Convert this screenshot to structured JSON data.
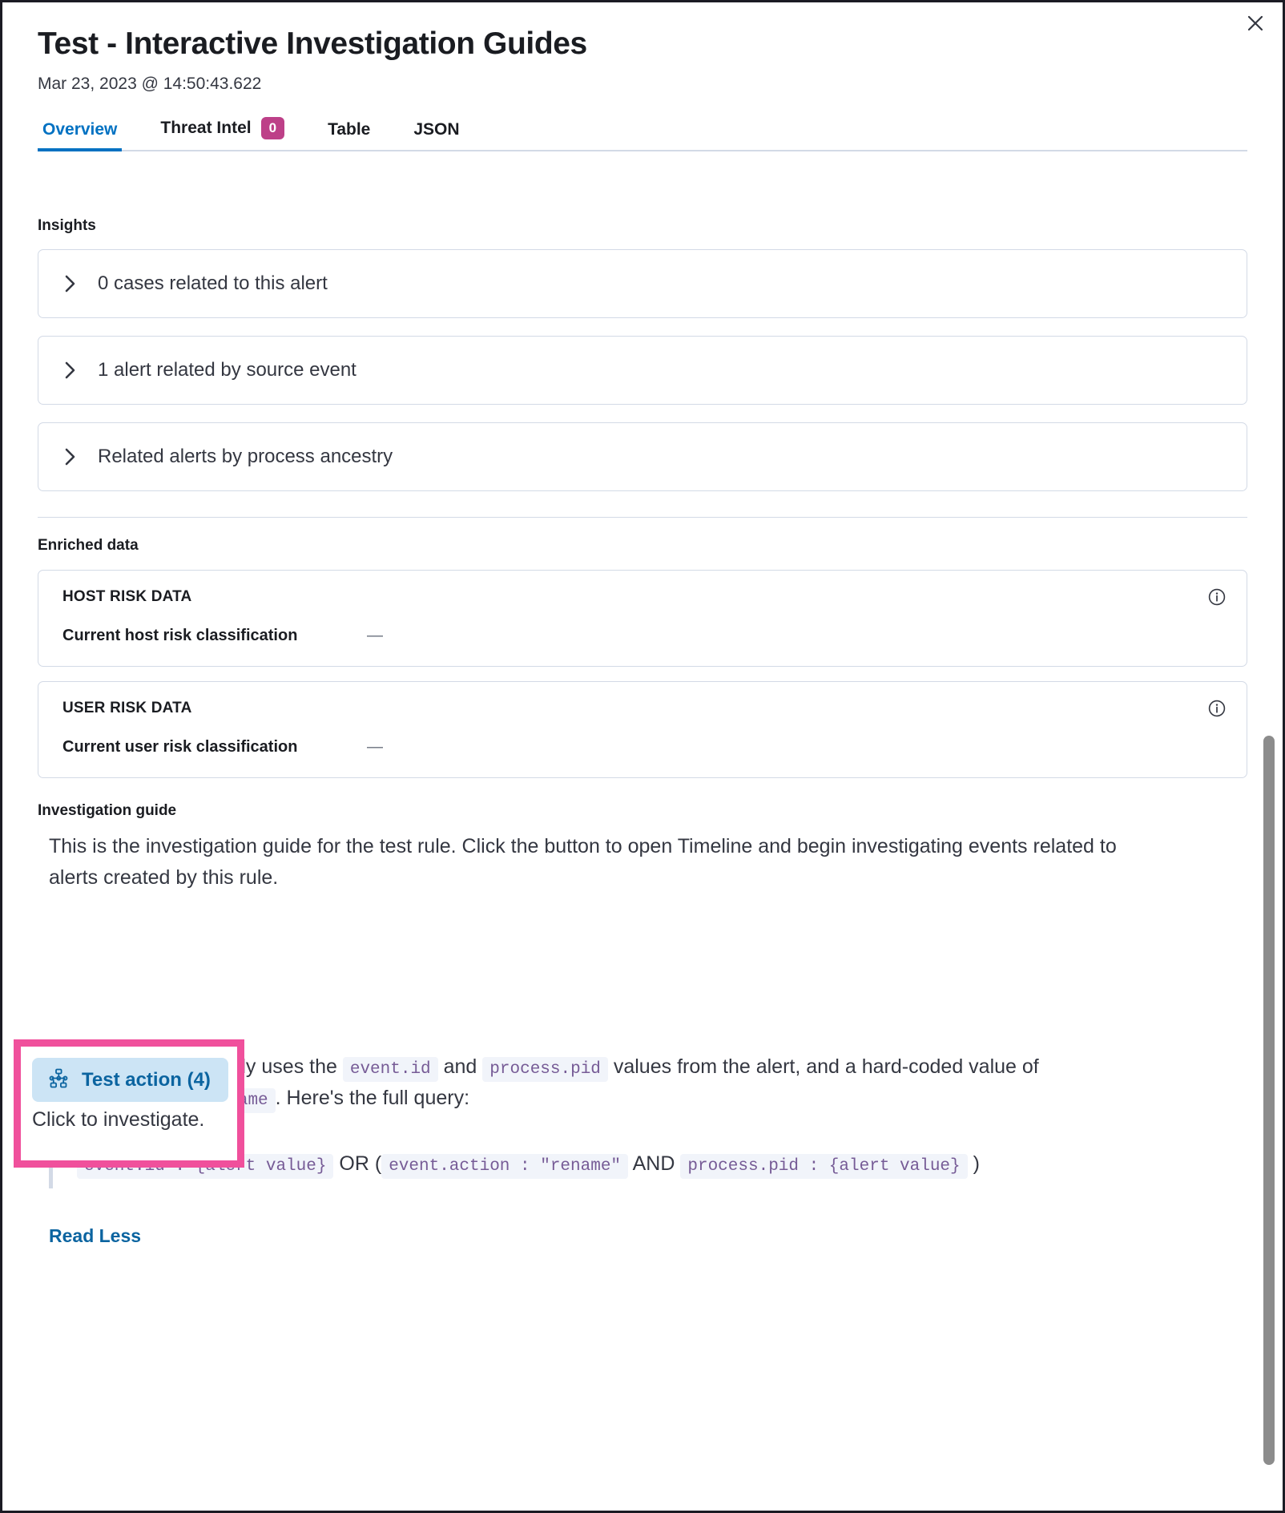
{
  "header": {
    "title": "Test - Interactive Investigation Guides",
    "timestamp": "Mar 23, 2023 @ 14:50:43.622",
    "close_label": "×"
  },
  "tabs": [
    {
      "label": "Overview",
      "badge": null,
      "active": true
    },
    {
      "label": "Threat Intel",
      "badge": "0",
      "active": false
    },
    {
      "label": "Table",
      "badge": null,
      "active": false
    },
    {
      "label": "JSON",
      "badge": null,
      "active": false
    }
  ],
  "insights": {
    "label": "Insights",
    "items": [
      {
        "text": "0 cases related to this alert"
      },
      {
        "text": "1 alert related by source event"
      },
      {
        "text": "Related alerts by process ancestry"
      }
    ]
  },
  "enriched": {
    "label": "Enriched data",
    "cards": [
      {
        "title": "HOST RISK DATA",
        "key": "Current host risk classification",
        "value": "—"
      },
      {
        "title": "USER RISK DATA",
        "key": "Current user risk classification",
        "value": "—"
      }
    ]
  },
  "guide": {
    "label": "Investigation guide",
    "intro": "This is the investigation guide for the test rule. Click the button to open Timeline and begin investigating events related to alerts created by this rule.",
    "action_button_label": "Test action (4)",
    "click_note": "Click to investigate.",
    "desc_part1": "This action dynamically uses the ",
    "code_event_id": "event.id",
    "desc_and": " and ",
    "code_process_pid": "process.pid",
    "desc_part2": " values from the alert, and a hard-coded value of ",
    "code_event_action": "event.action : rename",
    "desc_part3": ". Here's the full query:",
    "query": {
      "code1": "event.id : {alert value}",
      "op1": "OR",
      "paren_open": "(",
      "code2": "event.action : \"rename\"",
      "op2": "AND",
      "code3": "process.pid : {alert value}",
      "paren_close": ")"
    },
    "read_less_label": "Read Less"
  },
  "colors": {
    "accent_blue": "#0071c2",
    "badge_magenta": "#bd4088",
    "highlight_pink": "#f0509c",
    "action_bg": "#cce4f5",
    "code_purple": "#765b96",
    "border_gray": "#d3dae6"
  }
}
